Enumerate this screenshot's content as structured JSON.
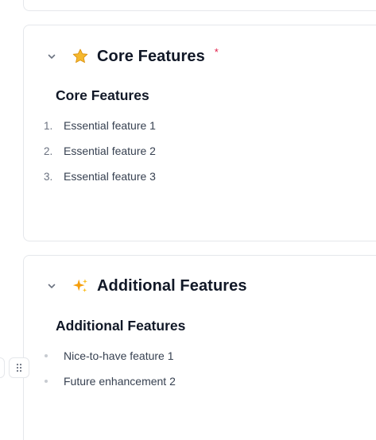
{
  "sections": [
    {
      "emoji": "⭐",
      "emoji_icon": "star-icon",
      "title": "Core Features",
      "required_mark": "*",
      "content_title": "Core Features",
      "list_type": "ordered",
      "items": [
        {
          "marker": "1.",
          "text": "Essential feature 1"
        },
        {
          "marker": "2.",
          "text": "Essential feature 2"
        },
        {
          "marker": "3.",
          "text": "Essential feature 3"
        }
      ]
    },
    {
      "emoji": "✨",
      "emoji_icon": "sparkles-icon",
      "title": "Additional Features",
      "content_title": "Additional Features",
      "list_type": "bulleted",
      "items": [
        {
          "text": "Nice-to-have feature 1"
        },
        {
          "text": "Future enhancement 2"
        }
      ]
    }
  ],
  "colors": {
    "required": "#e11d48",
    "border": "#e5e7eb",
    "star": "#f5b82e",
    "sparkle": "#f59e0b"
  }
}
